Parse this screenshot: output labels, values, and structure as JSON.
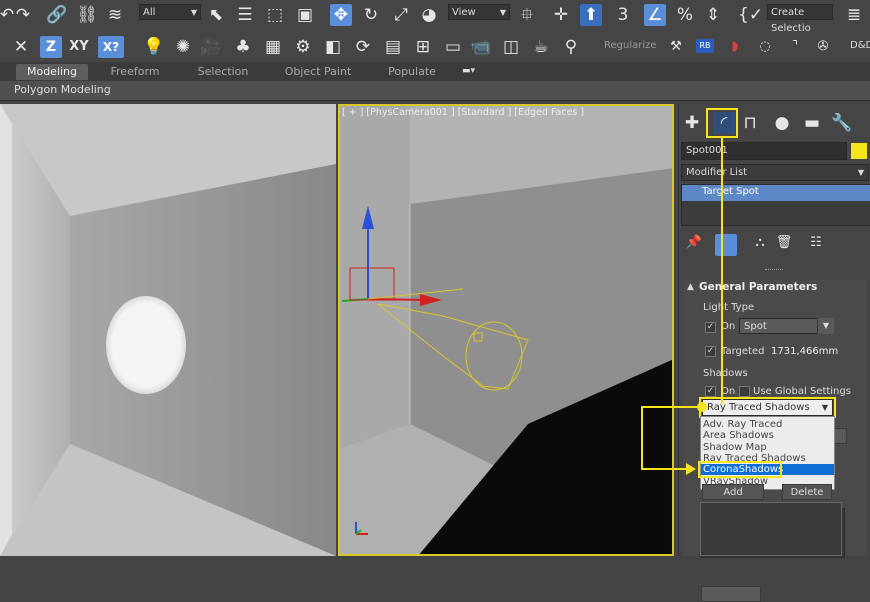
{
  "toolbar": {
    "filter_select": "All",
    "view_select": "View",
    "create_selection": "Create Selectio",
    "regularize": "Regularize",
    "rb_label": "RB",
    "xy_label": "XY",
    "z_label": "Z",
    "dd_label": "D&D",
    "snap_num": "3",
    "percent": "%"
  },
  "ribbon": {
    "tabs": [
      "Modeling",
      "Freeform",
      "Selection",
      "Object Paint",
      "Populate"
    ],
    "active": "Modeling",
    "sub_label": "Polygon Modeling"
  },
  "viewport_camera": {
    "label": "[ + ] [PhysCamera001 ] [Standard ] [Edged Faces ]"
  },
  "command_panel": {
    "object_name": "Spot001",
    "object_color": "#f5e51a",
    "modifier_list": "Modifier List",
    "stack_item": "Target Spot",
    "rollout_title": "General Parameters",
    "light_type_group": "Light Type",
    "on_label": "On",
    "light_type_value": "Spot",
    "targeted_label": "Targeted",
    "target_distance": "1731,466mm",
    "shadows_group": "Shadows",
    "shadows_on_label": "On",
    "use_global": "Use Global Settings",
    "shadow_type_value": "Ray Traced Shadows",
    "shadow_options": [
      "Adv. Ray Traced",
      "Area Shadows",
      "Shadow Map",
      "Ray Traced Shadows",
      "CoronaShadows",
      "VRayShadow"
    ],
    "selected_option": "CoronaShadows",
    "add_button": "Add",
    "delete_button": "Delete"
  },
  "colors": {
    "highlight": "#f5e51a",
    "selection_blue": "#0d6ed6",
    "viewport_border": "#d8c62a"
  }
}
